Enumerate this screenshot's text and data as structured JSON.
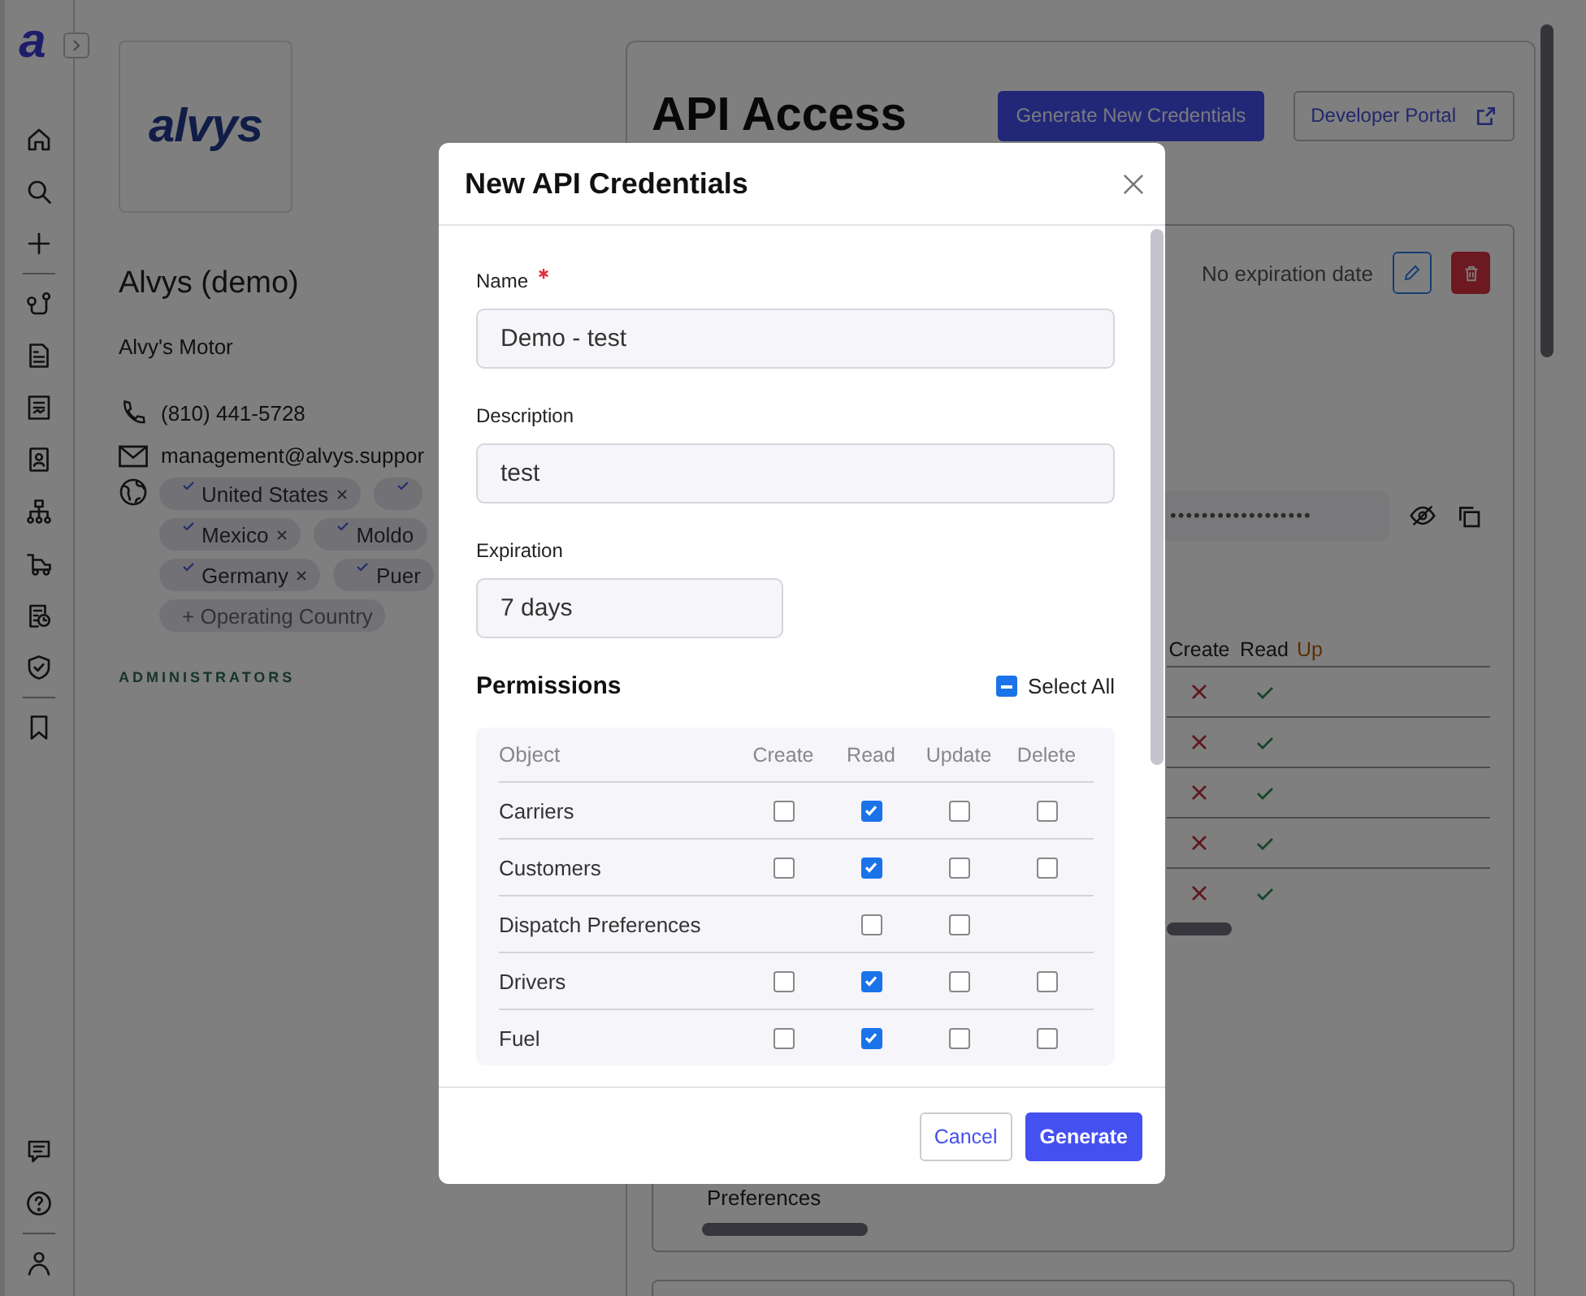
{
  "sidebar": {
    "logo": "a"
  },
  "profile": {
    "logo_text": "alvys",
    "name": "Alvys (demo)",
    "company": "Alvy's Motor",
    "phone": "(810) 441-5728",
    "email": "management@alvys.suppor",
    "country_rows": [
      [
        {
          "name": "United States",
          "removable": true
        },
        {
          "removable": false
        }
      ],
      [
        {
          "name": "Mexico",
          "removable": true
        },
        {
          "name": "Moldo",
          "removable": false
        }
      ],
      [
        {
          "name": "Germany",
          "removable": true
        },
        {
          "name": "Puer",
          "removable": false
        }
      ]
    ],
    "add_chip": "+ Operating Country",
    "section_label": "ADMINISTRATORS"
  },
  "api_access": {
    "title": "API Access",
    "buttons": [
      {
        "label": "Generate New Credentials",
        "kind": "primary"
      },
      {
        "label": "Developer Portal",
        "kind": "outline"
      }
    ],
    "credential": {
      "expiration": "No expiration date",
      "masked_secret": "••••••••••••••••••",
      "columns": [
        "Create",
        "Read",
        "Up"
      ],
      "rows": [
        {
          "create": false,
          "read": true
        },
        {
          "create": false,
          "read": true
        },
        {
          "create": false,
          "read": true
        },
        {
          "create": false,
          "read": true
        },
        {
          "create": false,
          "read": true
        }
      ],
      "footer_text": "Preferences"
    }
  },
  "modal": {
    "title": "New API Credentials",
    "fields": [
      {
        "label": "Name",
        "required": true,
        "value": "Demo - test",
        "kind": "text"
      },
      {
        "label": "Description",
        "required": false,
        "value": "test",
        "kind": "text"
      },
      {
        "label": "Expiration",
        "required": false,
        "value": "7 days",
        "kind": "select"
      }
    ],
    "permissions": {
      "title": "Permissions",
      "select_all": {
        "label": "Select All",
        "indeterminate": true
      },
      "columns": [
        "Object",
        "Create",
        "Read",
        "Update",
        "Delete"
      ],
      "rows": [
        {
          "object": "Carriers",
          "create": false,
          "read": true,
          "update": false,
          "delete": false
        },
        {
          "object": "Customers",
          "create": false,
          "read": true,
          "update": false,
          "delete": false
        },
        {
          "object": "Dispatch Preferences",
          "read": false,
          "update": false
        },
        {
          "object": "Drivers",
          "create": false,
          "read": true,
          "update": false,
          "delete": false
        },
        {
          "object": "Fuel",
          "create": false,
          "read": true,
          "update": false,
          "delete": false
        }
      ]
    },
    "buttons": [
      {
        "label": "Cancel",
        "kind": "secondary"
      },
      {
        "label": "Generate",
        "kind": "primary"
      }
    ]
  }
}
